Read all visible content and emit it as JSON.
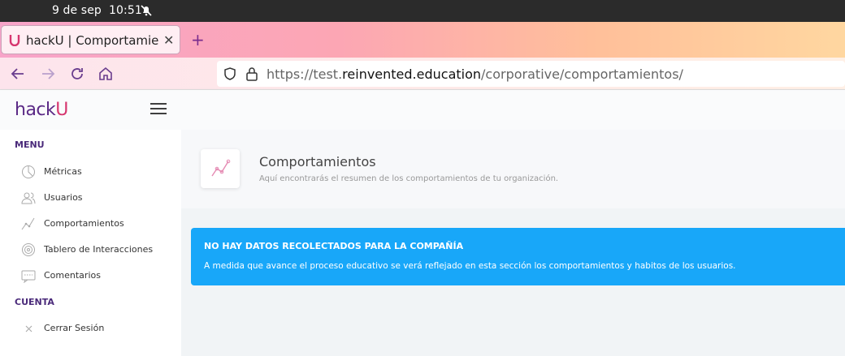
{
  "system": {
    "date": "9 de sep",
    "time": "10:51"
  },
  "browser": {
    "tab_title": "hackU | Comportamientos",
    "url_prefix": "https://test.",
    "url_domain": "reinvented.education",
    "url_path": "/corporative/comportamientos/"
  },
  "app": {
    "logo_main": "hack",
    "logo_accent": "U",
    "menu_section": "MENU",
    "menu_items": [
      {
        "label": "Métricas",
        "icon": "pie-chart-icon"
      },
      {
        "label": "Usuarios",
        "icon": "users-icon"
      },
      {
        "label": "Comportamientos",
        "icon": "line-chart-icon"
      },
      {
        "label": "Tablero de Interacciones",
        "icon": "target-icon"
      },
      {
        "label": "Comentarios",
        "icon": "comment-icon"
      }
    ],
    "account_section": "CUENTA",
    "account_items": [
      {
        "label": "Cerrar Sesión",
        "icon": "close-icon"
      }
    ]
  },
  "page": {
    "title": "Comportamientos",
    "subtitle": "Aquí encontrarás el resumen de los comportamientos de tu organización.",
    "alert_title": "NO HAY DATOS RECOLECTADOS PARA LA COMPAÑÍA",
    "alert_body": "A medida que avance el proceso educativo se verá reflejado en esta sección los comportamientos y habitos de los usuarios."
  },
  "colors": {
    "brand": "#5b2a86",
    "accent": "#d6366f",
    "alert": "#18a7f9"
  }
}
